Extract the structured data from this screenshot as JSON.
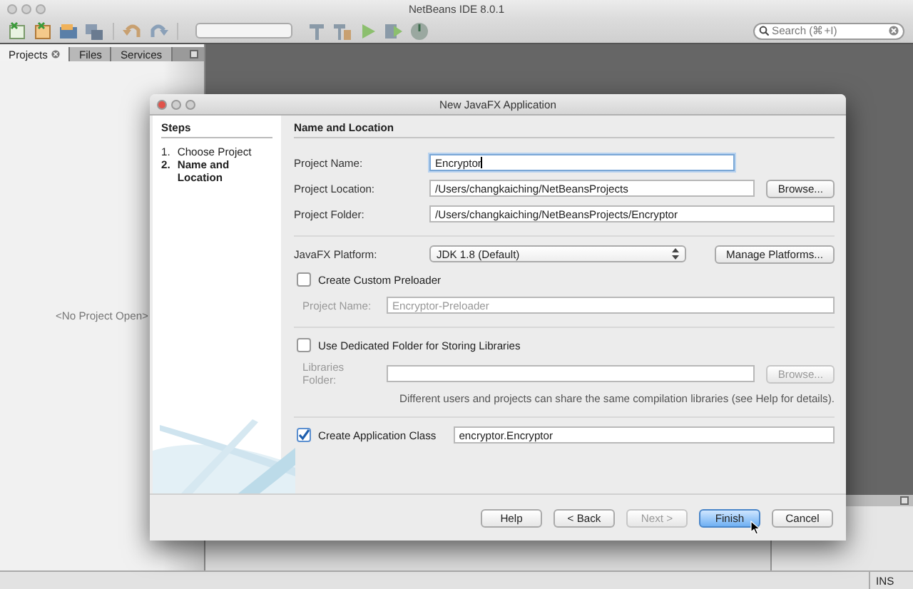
{
  "window": {
    "title": "NetBeans IDE 8.0.1"
  },
  "toolbar": {
    "search": {
      "placeholder": "Search (⌘+I)"
    }
  },
  "panel_tabs": [
    {
      "label": "Projects",
      "selected": true
    },
    {
      "label": "Files",
      "selected": false
    },
    {
      "label": "Services",
      "selected": false
    }
  ],
  "projects_panel": {
    "empty_text": "<No Project Open>"
  },
  "dialog": {
    "title": "New JavaFX Application",
    "steps_title": "Steps",
    "steps": [
      {
        "number": "1.",
        "label": "Choose Project",
        "selected": false
      },
      {
        "number": "2.",
        "label": "Name and Location",
        "selected": true
      }
    ],
    "section_title": "Name and Location",
    "groups": [
      {
        "rows": [
          {
            "kind": "field",
            "label": "Project Name:",
            "value": "Encryptor",
            "focused": true
          },
          {
            "kind": "field",
            "label": "Project Location:",
            "value": "/Users/changkaiching/NetBeansProjects",
            "button": {
              "label": "Browse...",
              "disabled": false
            }
          },
          {
            "kind": "field",
            "label": "Project Folder:",
            "value": "/Users/changkaiching/NetBeansProjects/Encryptor"
          }
        ]
      },
      {
        "rows": [
          {
            "kind": "select",
            "label": "JavaFX Platform:",
            "value": "JDK 1.8 (Default)",
            "button": {
              "label": "Manage Platforms...",
              "disabled": false
            }
          },
          {
            "kind": "checkbox",
            "label": "Create Custom Preloader",
            "checked": false
          },
          {
            "kind": "subfield",
            "label": "Project Name:",
            "value": "Encryptor-Preloader",
            "disabled": true
          }
        ]
      },
      {
        "rows": [
          {
            "kind": "checkbox",
            "label": "Use Dedicated Folder for Storing Libraries",
            "checked": false
          },
          {
            "kind": "subfield",
            "label": "Libraries Folder:",
            "disabled": true,
            "button": {
              "label": "Browse...",
              "disabled": true
            }
          },
          {
            "kind": "note",
            "text": "Different users and projects can share the same compilation libraries (see Help for details)."
          }
        ]
      },
      {
        "rows": [
          {
            "kind": "checkfield",
            "label": "Create Application Class",
            "checked": true,
            "value": "encryptor.Encryptor"
          }
        ]
      }
    ],
    "buttons": [
      {
        "label": "Help",
        "disabled": false,
        "default": false
      },
      {
        "label": "< Back",
        "disabled": false,
        "default": false
      },
      {
        "label": "Next >",
        "disabled": true,
        "default": false
      },
      {
        "label": "Finish",
        "disabled": false,
        "default": true
      },
      {
        "label": "Cancel",
        "disabled": false,
        "default": false
      }
    ]
  },
  "status_bar": {
    "mode": "INS"
  }
}
